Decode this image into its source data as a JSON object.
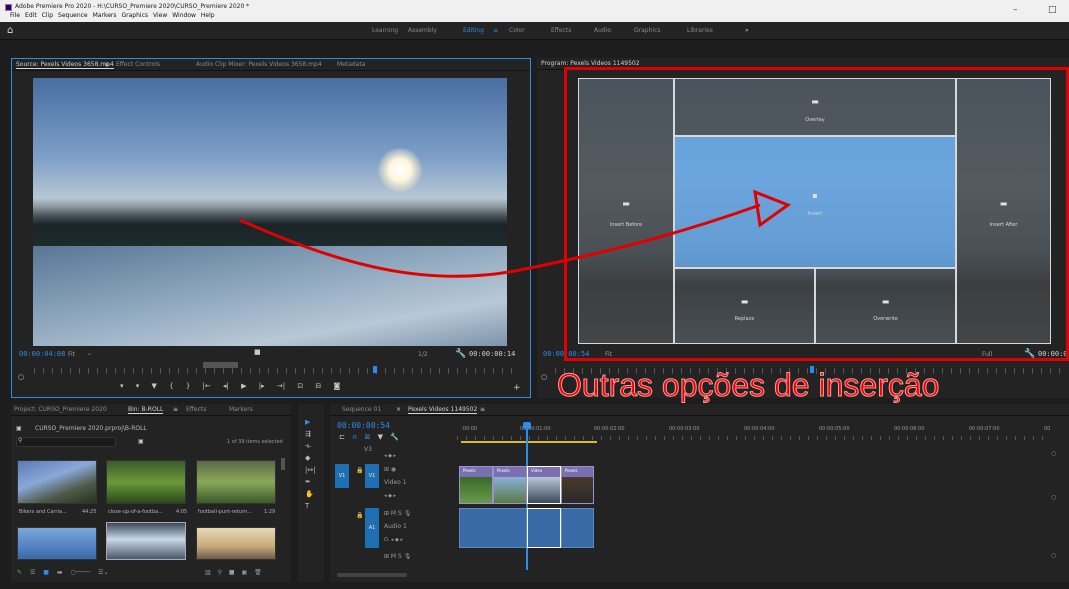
{
  "window": {
    "title": "Adobe Premiere Pro 2020 - H:\\CURSO_Premiere 2020\\CURSO_Premiere 2020 *",
    "menus": [
      "File",
      "Edit",
      "Clip",
      "Sequence",
      "Markers",
      "Graphics",
      "View",
      "Window",
      "Help"
    ],
    "minimize": "–",
    "restore": "□"
  },
  "workspaces": {
    "items": [
      "Learning",
      "Assembly",
      "Editing",
      "Color",
      "Effects",
      "Audio",
      "Graphics",
      "Libraries"
    ],
    "active": "Editing",
    "more": "»"
  },
  "source_panel": {
    "tabs": [
      "Source: Pexels Videos 3658.mp4",
      "Effect Controls",
      "Audio Clip Mixer: Pexels Videos 3658.mp4",
      "Metadata"
    ],
    "timecode": "00:00:04:08",
    "fit": "Fit",
    "zoom": "1/2",
    "duration": "00:00:00:14"
  },
  "program_panel": {
    "tab": "Program: Pexels Videos 1149502",
    "timecode": "00:00:00:54",
    "fit": "Fit",
    "quality": "Full",
    "duration": "00:00:0",
    "zones": {
      "overlay": "Overlay",
      "insert_before": "Insert Before",
      "insert": "Insert",
      "insert_after": "Insert After",
      "replace": "Replace",
      "overwrite": "Overwrite"
    }
  },
  "annotation": {
    "text": "Outras opções de inserção",
    "color": "#e60000"
  },
  "project_panel": {
    "tabs": [
      "Project: CURSO_Premiere 2020",
      "Bin: B-ROLL",
      "Effects",
      "Markers"
    ],
    "path": "CURSO_Premiere 2020.prproj\\B-ROLL",
    "selection": "1 of 39 items selected",
    "search_placeholder": "",
    "items": [
      {
        "name": "Bikers and Carria...",
        "duration": "44:25"
      },
      {
        "name": "close-up-of-a-footba...",
        "duration": "4:05"
      },
      {
        "name": "football-punt-return...",
        "duration": "1:29"
      }
    ]
  },
  "timeline": {
    "tabs": [
      "Sequence 01",
      "Pexels Videos 1149502"
    ],
    "timecode": "00:00:00:54",
    "ruler": [
      ":00:00",
      "00:00:01:00",
      "00:00:02:00",
      "00:00:03:00",
      "00:00:04:00",
      "00:00:05:00",
      "00:00:06:00",
      "00:00:07:00",
      "00"
    ],
    "tracks": {
      "v3": "V3",
      "v1": "V1",
      "video1": "Video 1",
      "a1": "A1",
      "audio1": "Audio 1"
    },
    "clip_labels": [
      "Pexels",
      "Pexels",
      "Video",
      "Pexels"
    ]
  },
  "colors": {
    "accent": "#2d8ceb",
    "bg": "#232323",
    "highlight": "#e10000"
  }
}
